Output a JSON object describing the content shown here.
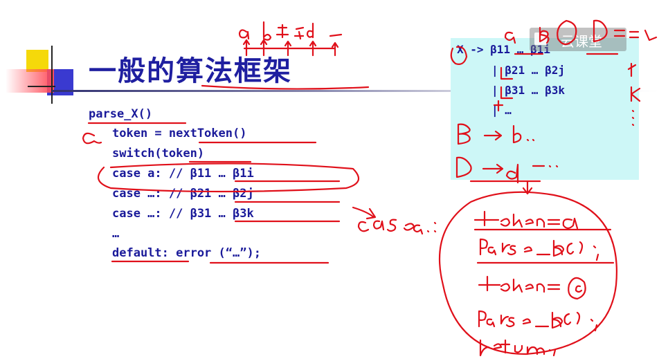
{
  "slide": {
    "title": "一般的算法框架",
    "code_lines": [
      "parse_X()",
      "token = nextToken()",
      "switch(token)",
      "case a: // β11 … β1i",
      "case …: // β21 … β2j",
      "case …: // β31 … β3k",
      "…",
      "default: error (“…”);"
    ],
    "grammar_lines": [
      "X -> β11 … β1i",
      "| β21 … β2j",
      "| β31 … β3k",
      "| …"
    ]
  },
  "watermark": {
    "label": "云课堂"
  },
  "colors": {
    "title": "#1f1fa0",
    "code": "#1a1a9a",
    "ink": "#e0101a",
    "box": "#cdf7f7"
  }
}
